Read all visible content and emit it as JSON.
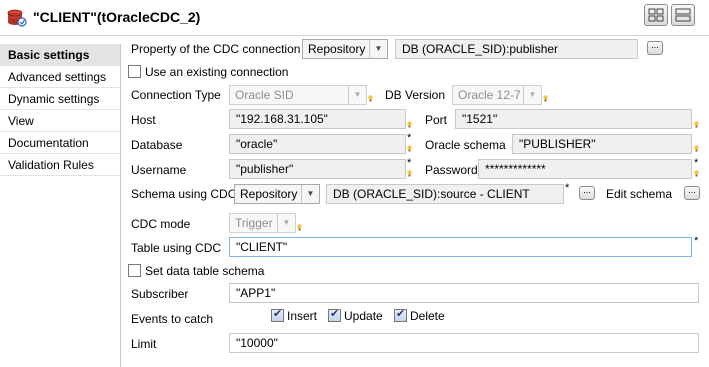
{
  "header": {
    "title": "\"CLIENT\"(tOracleCDC_2)"
  },
  "sidebar": {
    "items": [
      {
        "label": "Basic settings"
      },
      {
        "label": "Advanced settings"
      },
      {
        "label": "Dynamic settings"
      },
      {
        "label": "View"
      },
      {
        "label": "Documentation"
      },
      {
        "label": "Validation Rules"
      }
    ]
  },
  "form": {
    "property_label": "Property of the CDC connection",
    "property_type": "Repository",
    "property_value": "DB (ORACLE_SID):publisher",
    "use_existing_label": "Use an existing connection",
    "connection_type_label": "Connection Type",
    "connection_type_value": "Oracle SID",
    "db_version_label": "DB Version",
    "db_version_value": "Oracle 12-7",
    "host_label": "Host",
    "host_value": "\"192.168.31.105\"",
    "port_label": "Port",
    "port_value": "\"1521\"",
    "database_label": "Database",
    "database_value": "\"oracle\"",
    "oracle_schema_label": "Oracle schema",
    "oracle_schema_value": "\"PUBLISHER\"",
    "username_label": "Username",
    "username_value": "\"publisher\"",
    "password_label": "Password",
    "password_value": "*************",
    "schema_cdc_label": "Schema using CDC",
    "schema_cdc_type": "Repository",
    "schema_cdc_value": "DB (ORACLE_SID):source - CLIENT",
    "edit_schema_label": "Edit schema",
    "cdc_mode_label": "CDC mode",
    "cdc_mode_value": "Trigger",
    "table_cdc_label": "Table using CDC",
    "table_cdc_value": "\"CLIENT\"",
    "set_data_table_label": "Set data table schema",
    "subscriber_label": "Subscriber",
    "subscriber_value": "\"APP1\"",
    "events_label": "Events to catch",
    "event_insert": "Insert",
    "event_update": "Update",
    "event_delete": "Delete",
    "limit_label": "Limit",
    "limit_value": "\"10000\"",
    "required_mark": "*",
    "dots_label": "..."
  }
}
